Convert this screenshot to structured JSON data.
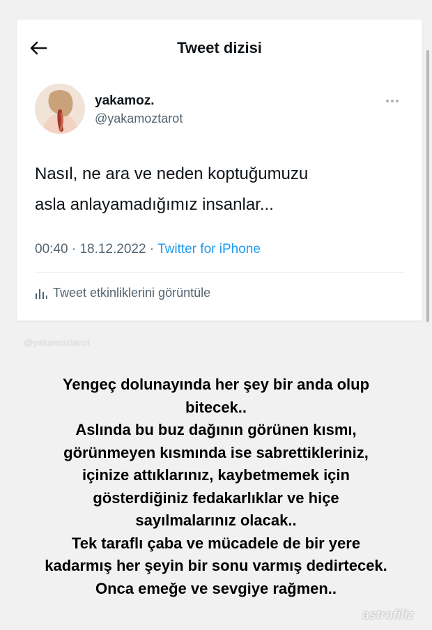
{
  "header": {
    "title": "Tweet dizisi"
  },
  "tweet": {
    "display_name": "yakamoz.",
    "handle": "@yakamoztarot",
    "text_lines": [
      "Nasıl, ne ara ve neden koptuğumuzu",
      "asla anlayamadığımız insanlar..."
    ],
    "time": "00:40",
    "date": "18.12.2022",
    "separator": " · ",
    "source": "Twitter for iPhone",
    "analytics_label": "Tweet etkinliklerini görüntüle"
  },
  "watermark_top": "@yakamoztarot",
  "story_lines": [
    "Yengeç dolunayında her şey bir anda olup",
    "bitecek..",
    "Aslında bu buz dağının görünen kısmı,",
    "görünmeyen kısmında ise sabrettikleriniz,",
    "içinize attıklarınız, kaybetmemek için",
    "gösterdiğiniz fedakarlıklar ve hiçe",
    "sayılmalarınız olacak..",
    "Tek taraflı çaba ve mücadele de bir yere",
    "kadarmış her şeyin bir sonu varmış dedirtecek.",
    "Onca emeğe ve sevgiye rağmen.."
  ],
  "watermark_bottom": "astrofiliz",
  "colors": {
    "link": "#1d9bf0",
    "muted": "#536471",
    "text": "#0f1419"
  },
  "icons": [
    "back-arrow-icon",
    "more-icon",
    "analytics-icon"
  ]
}
